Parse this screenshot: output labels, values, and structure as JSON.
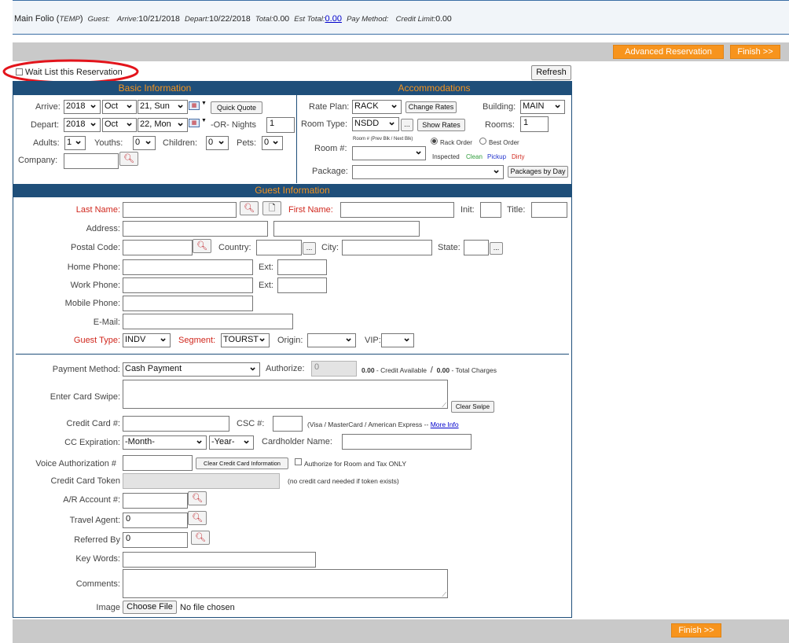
{
  "folio": {
    "title": "Main Folio (",
    "temp": "TEMP",
    "title_end": ")",
    "guest_label": "Guest:",
    "arrive_label": "Arrive:",
    "arrive_value": "10/21/2018",
    "depart_label": "Depart:",
    "depart_value": "10/22/2018",
    "total_label": "Total:",
    "total_value": "0.00",
    "est_total_label": "Est Total:",
    "est_total_value": "0.00",
    "pay_method_label": "Pay Method:",
    "credit_limit_label": "Credit Limit:",
    "credit_limit_value": "0.00"
  },
  "toolbar": {
    "advanced_reservation": "Advanced Reservation",
    "finish_top": "Finish >>",
    "finish_bottom": "Finish >>"
  },
  "waitlist_label": "Wait List this Reservation",
  "refresh_label": "Refresh",
  "basic": {
    "header": "Basic Information",
    "arrive_label": "Arrive:",
    "arrive_year": "2018",
    "arrive_month": "Oct",
    "arrive_day": "21, Sun",
    "quick_quote": "Quick Quote",
    "depart_label": "Depart:",
    "depart_year": "2018",
    "depart_month": "Oct",
    "depart_day": "22, Mon",
    "or_nights_label": "-OR- Nights",
    "nights": "1",
    "adults_label": "Adults:",
    "adults": "1",
    "youths_label": "Youths:",
    "youths": "0",
    "children_label": "Children:",
    "children": "0",
    "pets_label": "Pets:",
    "pets": "0",
    "company_label": "Company:"
  },
  "accom": {
    "header": "Accommodations",
    "rate_plan_label": "Rate Plan:",
    "rate_plan": "RACK",
    "change_rates": "Change Rates",
    "building_label": "Building:",
    "building": "MAIN",
    "room_type_label": "Room Type:",
    "room_type": "NSDD",
    "dots": "...",
    "show_rates": "Show Rates",
    "rooms_label": "Rooms:",
    "rooms": "1",
    "room_num_hint": "Room # (Prev Blk / Next Blk)",
    "rack_order": "Rack Order",
    "best_order": "Best Order",
    "room_num_label": "Room #:",
    "inspected": "Inspected",
    "clean": "Clean",
    "pickup": "Pickup",
    "dirty": "Dirty",
    "package_label": "Package:",
    "packages_by_day": "Packages by Day"
  },
  "guest": {
    "header": "Guest Information",
    "last_name_label": "Last Name:",
    "first_name_label": "First Name:",
    "init_label": "Init:",
    "title_label": "Title:",
    "address_label": "Address:",
    "postal_code_label": "Postal Code:",
    "country_label": "Country:",
    "city_label": "City:",
    "state_label": "State:",
    "home_phone_label": "Home Phone:",
    "work_phone_label": "Work Phone:",
    "ext_label": "Ext:",
    "mobile_phone_label": "Mobile Phone:",
    "email_label": "E-Mail:",
    "guest_type_label": "Guest Type:",
    "guest_type": "INDV",
    "segment_label": "Segment:",
    "segment": "TOURST",
    "origin_label": "Origin:",
    "vip_label": "VIP:"
  },
  "payment": {
    "method_label": "Payment Method:",
    "method": "Cash Payment",
    "authorize_label": "Authorize:",
    "authorize_value": "0",
    "credit_available_value": "0.00",
    "credit_available_label": "- Credit Available",
    "slash": "/",
    "total_charges_value": "0.00",
    "total_charges_label": "- Total Charges",
    "card_swipe_label": "Enter Card Swipe:",
    "clear_swipe": "Clear Swipe",
    "credit_card_label": "Credit Card #:",
    "csc_label": "CSC #:",
    "card_types": "(Visa / MasterCard / American Express --",
    "more_info": "More Info",
    "cc_exp_label": "CC Expiration:",
    "exp_month": "-Month-",
    "exp_year": "-Year-",
    "cardholder_label": "Cardholder Name:",
    "voice_auth_label": "Voice Authorization #",
    "clear_cc": "Clear Credit Card Information",
    "auth_room_tax": "Authorize for Room and Tax ONLY",
    "token_label": "Credit Card Token",
    "token_note": "(no credit card needed if token exists)",
    "ar_account_label": "A/R Account #:",
    "travel_agent_label": "Travel Agent:",
    "travel_agent": "0",
    "referred_by_label": "Referred By",
    "referred_by": "0",
    "key_words_label": "Key Words:",
    "comments_label": "Comments:",
    "image_label": "Image",
    "choose_file": "Choose File",
    "no_file": "No file chosen"
  }
}
